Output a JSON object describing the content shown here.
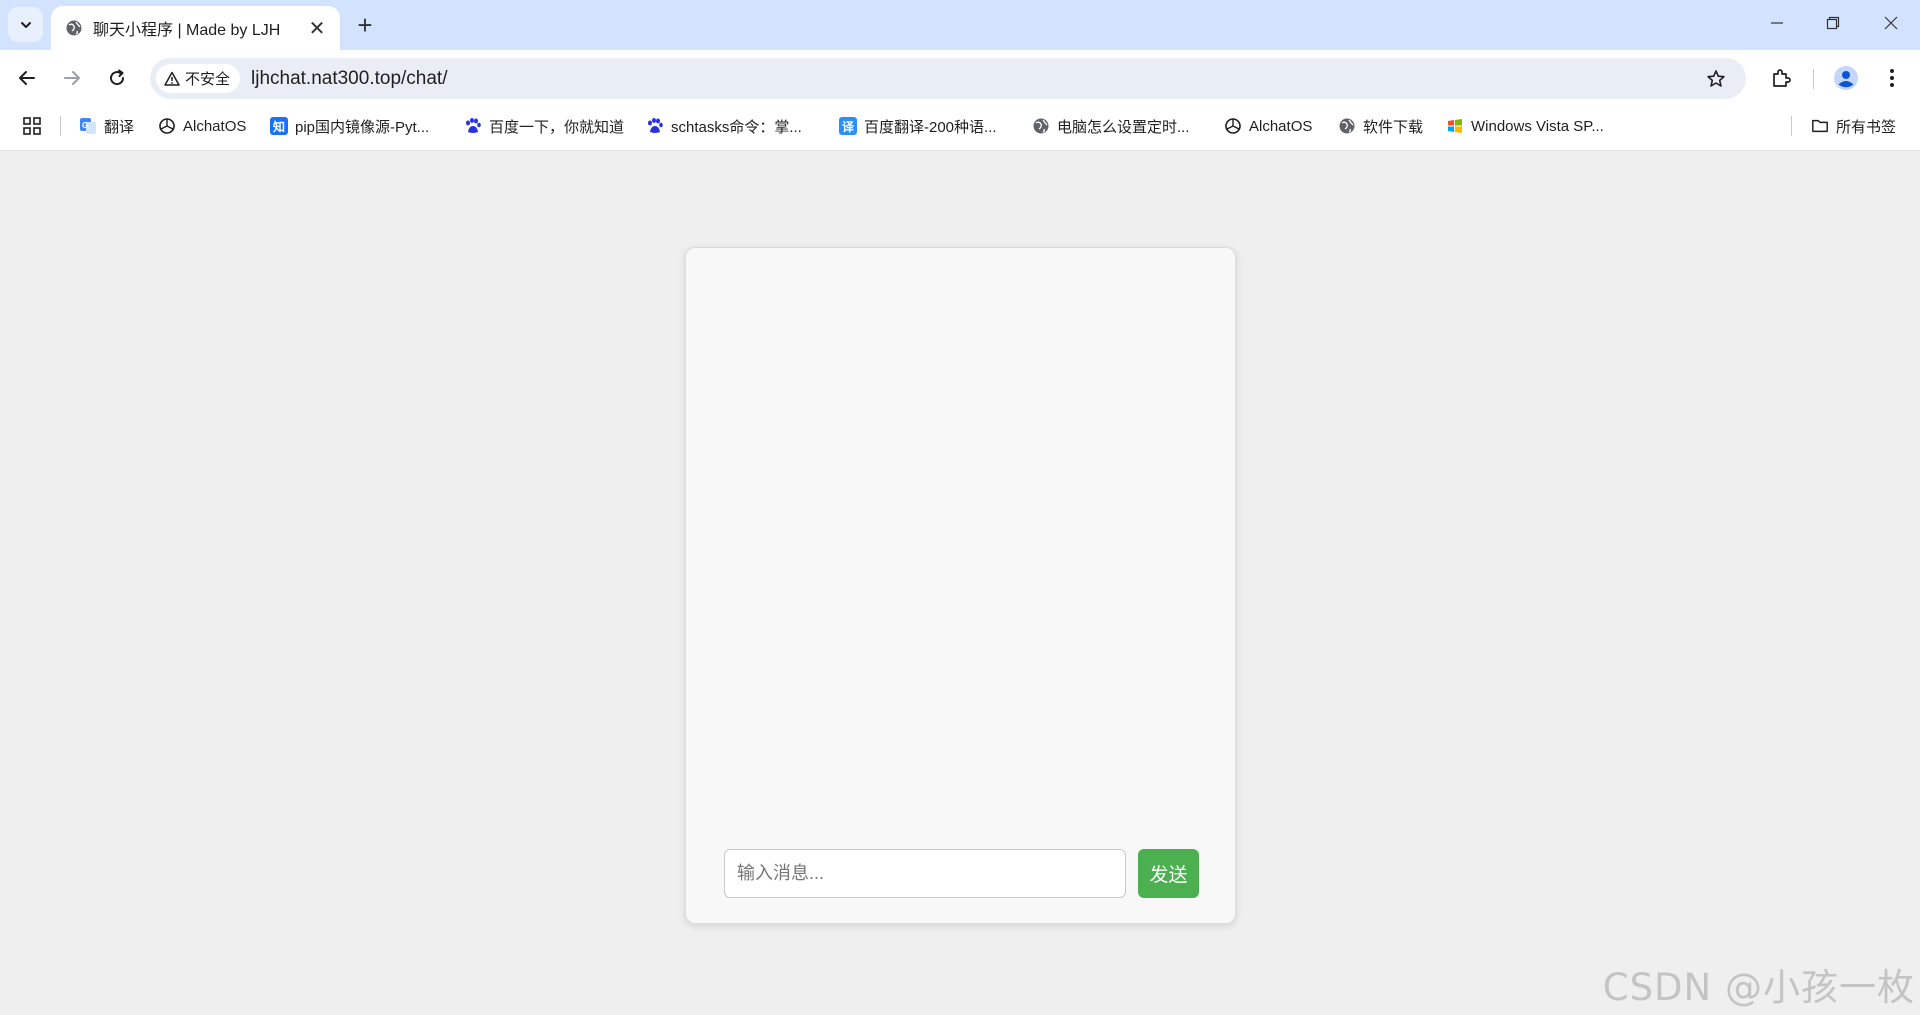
{
  "browser": {
    "tab": {
      "title": "聊天小程序 | Made by LJH",
      "close_glyph": "✕"
    },
    "new_tab_glyph": "+",
    "window_controls": {
      "minimize": "—",
      "restore": "❐",
      "close": "✕"
    },
    "address_bar": {
      "security_label": "不安全",
      "url": "ljhchat.nat300.top/chat/"
    },
    "bookmarks": [
      {
        "label": "翻译",
        "icon": "google-translate-icon"
      },
      {
        "label": "AlchatOS",
        "icon": "openai-icon"
      },
      {
        "label": "pip国内镜像源-Pyt...",
        "icon": "zhihu-icon",
        "icon_text": "知"
      },
      {
        "label": "百度一下，你就知道",
        "icon": "baidu-icon"
      },
      {
        "label": "schtasks命令：掌...",
        "icon": "baidu-icon"
      },
      {
        "label": "百度翻译-200种语...",
        "icon": "baidu-translate-icon",
        "icon_text": "译"
      },
      {
        "label": "电脑怎么设置定时...",
        "icon": "globe-icon"
      },
      {
        "label": "AlchatOS",
        "icon": "openai-icon"
      },
      {
        "label": "软件下载",
        "icon": "globe-icon"
      },
      {
        "label": "Windows Vista SP...",
        "icon": "windows-icon"
      }
    ],
    "all_bookmarks_label": "所有书签"
  },
  "chat": {
    "input_placeholder": "输入消息...",
    "input_value": "",
    "send_label": "发送"
  },
  "watermark": "CSDN @小孩一枚",
  "colors": {
    "tabstrip": "#d3e3fd",
    "page_bg": "#efefef",
    "card_bg": "#f8f8f8",
    "send_button": "#4caf50"
  }
}
